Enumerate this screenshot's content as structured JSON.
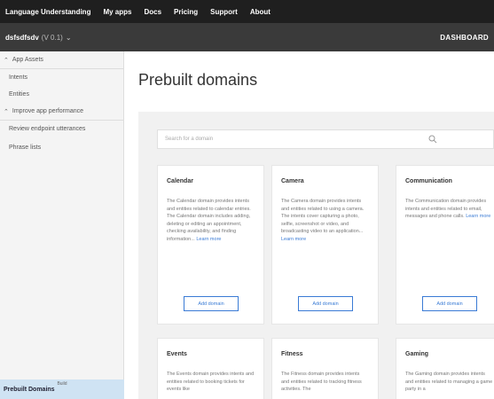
{
  "topnav": {
    "brand": "Language Understanding",
    "links": [
      "My apps",
      "Docs",
      "Pricing",
      "Support",
      "About"
    ]
  },
  "subnav": {
    "app_name": "dsfsdfsdv",
    "app_meta": "(V 0.1)",
    "dashboard": "DASHBOARD"
  },
  "sidebar": {
    "sections": [
      {
        "label": "App Assets",
        "items": [
          "Intents",
          "Entities"
        ]
      },
      {
        "label": "Improve app performance",
        "items": [
          "Review endpoint utterances",
          "Phrase lists"
        ]
      }
    ],
    "footer": {
      "small": "Build",
      "label": "Prebuilt Domains"
    }
  },
  "main": {
    "title": "Prebuilt domains",
    "search_placeholder": "Search for a domain",
    "cards": [
      {
        "title": "Calendar",
        "desc": "The Calendar domain provides intents and entities related to calendar entries. The Calendar domain includes adding, deleting or editing an appointment, checking availability, and finding information...",
        "more": "Learn more",
        "button": "Add domain"
      },
      {
        "title": "Camera",
        "desc": "The Camera domain provides intents and entities related to using a camera. The intents cover capturing a photo, selfie, screenshot or video, and broadcasting video to an application...",
        "more": "Learn more",
        "button": "Add domain"
      },
      {
        "title": "Communication",
        "desc": "The Communication domain provides intents and entities related to email, messages and phone calls.",
        "more": "Learn more",
        "button": "Add domain"
      },
      {
        "title": "Events",
        "desc": "The Events domain provides intents and entities related to booking tickets for events like",
        "more": "",
        "button": ""
      },
      {
        "title": "Fitness",
        "desc": "The Fitness domain provides intents and entities related to tracking fitness activities. The",
        "more": "",
        "button": ""
      },
      {
        "title": "Gaming",
        "desc": "The Gaming domain provides intents and entities related to managing a game party in a",
        "more": "",
        "button": ""
      }
    ]
  },
  "colors": {
    "topnav_bg": "#1f1f1f",
    "subnav_bg": "#3a3a3a",
    "accent": "#3a7bd5",
    "sidebar_active": "#cfe3f3"
  }
}
